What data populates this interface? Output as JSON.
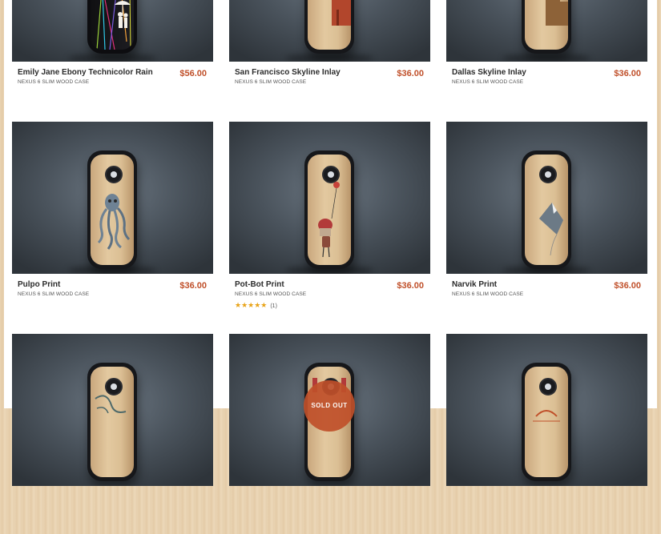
{
  "products": [
    {
      "title": "Emily Jane Ebony Technicolor Rain",
      "subtitle": "NEXUS 6 SLIM WOOD CASE",
      "price": "$56.00",
      "art_icon": "umbrella-couple-icon"
    },
    {
      "title": "San Francisco Skyline Inlay",
      "subtitle": "NEXUS 6 SLIM WOOD CASE",
      "price": "$36.00",
      "art_icon": "skyline-icon"
    },
    {
      "title": "Dallas Skyline Inlay",
      "subtitle": "NEXUS 6 SLIM WOOD CASE",
      "price": "$36.00",
      "art_icon": "skyline-icon"
    },
    {
      "title": "Pulpo Print",
      "subtitle": "NEXUS 6 SLIM WOOD CASE",
      "price": "$36.00",
      "art_icon": "octopus-icon"
    },
    {
      "title": "Pot-Bot Print",
      "subtitle": "NEXUS 6 SLIM WOOD CASE",
      "price": "$36.00",
      "art_icon": "robot-balloon-icon",
      "rating": {
        "stars": "★★★★★",
        "count": "(1)",
        "value": 5
      }
    },
    {
      "title": "Narvik Print",
      "subtitle": "NEXUS 6 SLIM WOOD CASE",
      "price": "$36.00",
      "art_icon": "mountain-icon"
    },
    {
      "art_icon": "tentacle-icon"
    },
    {
      "art_icon": "robot-icon",
      "badge": "SOLD OUT"
    },
    {
      "art_icon": "sunset-icon"
    }
  ],
  "colors": {
    "price": "#c0502a",
    "star": "#e8a317",
    "wood": "#e3c9a0",
    "backdrop": "#4a535c"
  }
}
